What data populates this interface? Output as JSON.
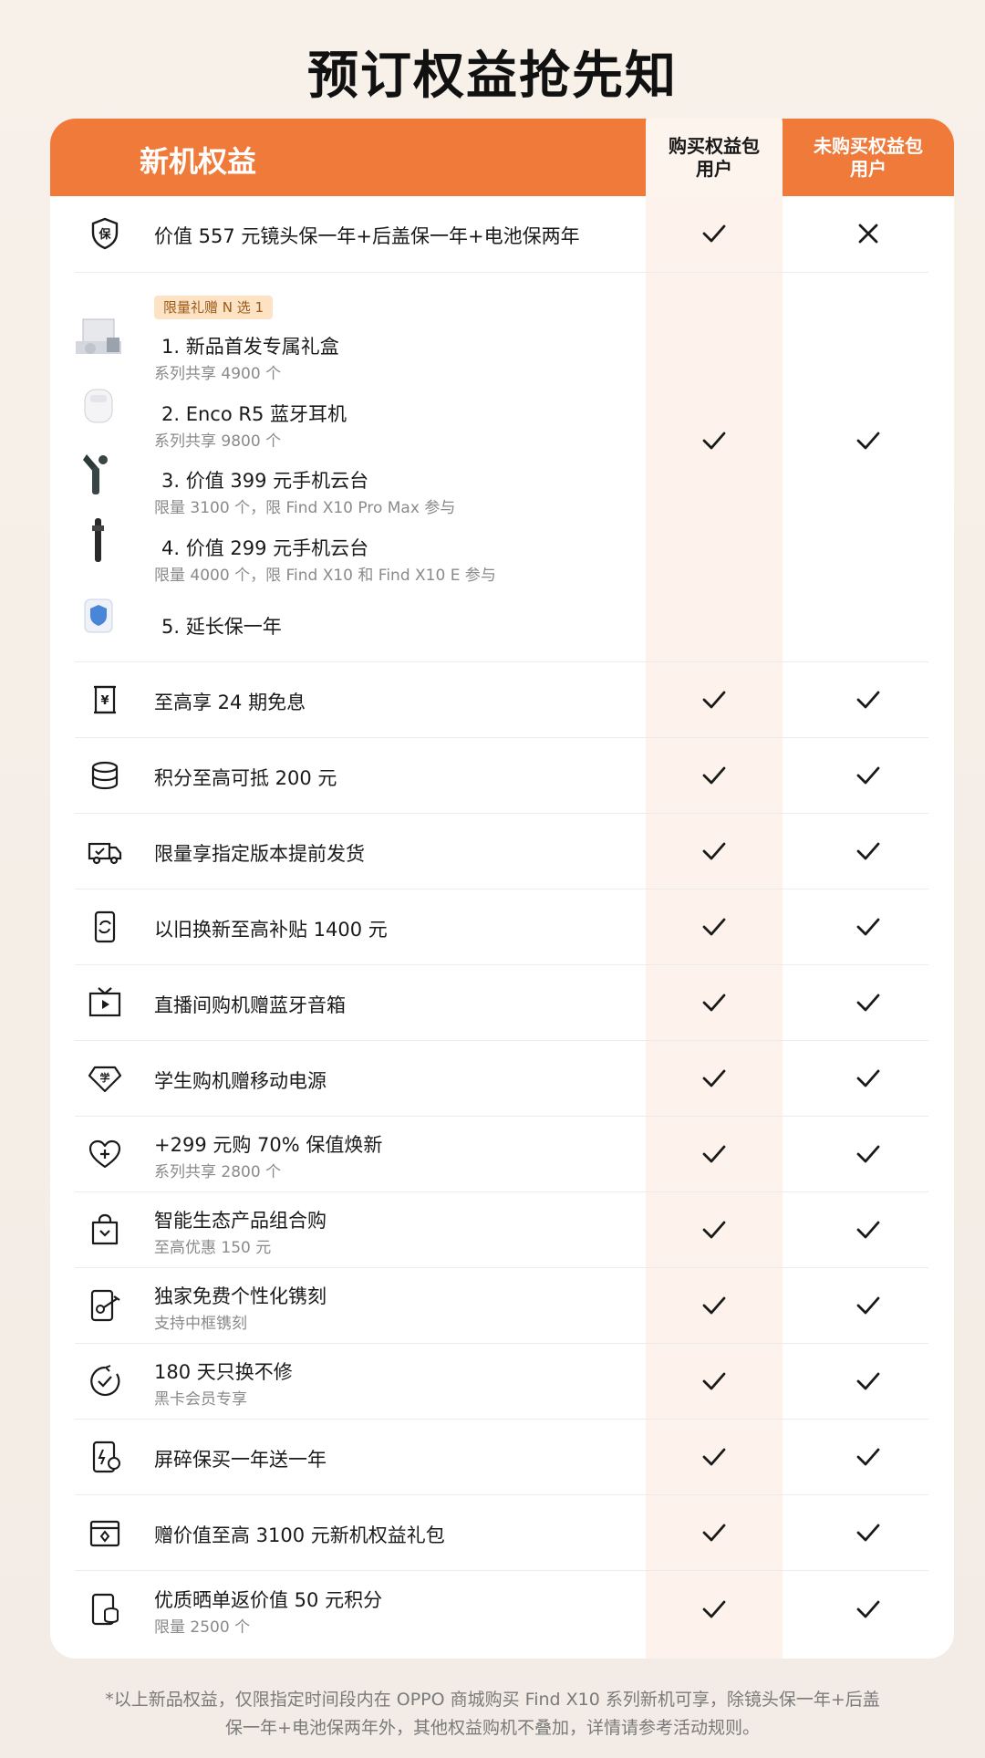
{
  "title": "预订权益抢先知",
  "header": {
    "section_title": "新机权益",
    "col1": "购买权益包\n用户",
    "col2": "未购买权益包\n用户"
  },
  "row_protection": {
    "icon": "shield-bao-icon",
    "label": "价值 557 元镜头保一年+后盖保一年+电池保两年",
    "col1": "check",
    "col2": "cross"
  },
  "gifts": {
    "tag": "限量礼赠 N 选 1",
    "items": [
      {
        "label": "1. 新品首发专属礼盒",
        "sub": "系列共享 4900 个",
        "thumb": "gift-box-thumbnail"
      },
      {
        "label": "2. Enco R5 蓝牙耳机",
        "sub": "系列共享 9800 个",
        "thumb": "earbuds-thumbnail"
      },
      {
        "label": "3. 价值 399 元手机云台",
        "sub": "限量 3100 个，限 Find X10 Pro Max 参与",
        "thumb": "gimbal-thumbnail"
      },
      {
        "label": "4. 价值 299 元手机云台",
        "sub": "限量 4000 个，限 Find X10 和 Find X10 E 参与",
        "thumb": "selfie-stick-thumbnail"
      },
      {
        "label": "5. 延长保一年",
        "sub": "",
        "thumb": "warranty-shield-thumbnail"
      }
    ],
    "col1": "check",
    "col2": "check"
  },
  "rows": [
    {
      "icon": "yuan-bill-icon",
      "label": "至高享 24 期免息",
      "sub": "",
      "col1": "check",
      "col2": "check"
    },
    {
      "icon": "coin-stack-icon",
      "label": "积分至高可抵 200 元",
      "sub": "",
      "col1": "check",
      "col2": "check"
    },
    {
      "icon": "delivery-truck-icon",
      "label": "限量享指定版本提前发货",
      "sub": "",
      "col1": "check",
      "col2": "check"
    },
    {
      "icon": "phone-refresh-icon",
      "label": "以旧换新至高补贴 1400 元",
      "sub": "",
      "col1": "check",
      "col2": "check"
    },
    {
      "icon": "tv-play-icon",
      "label": "直播间购机赠蓝牙音箱",
      "sub": "",
      "col1": "check",
      "col2": "check"
    },
    {
      "icon": "student-diamond-icon",
      "label": "学生购机赠移动电源",
      "sub": "",
      "col1": "check",
      "col2": "check"
    },
    {
      "icon": "heart-plus-icon",
      "label": "+299 元购 70% 保值焕新",
      "sub": "系列共享 2800 个",
      "col1": "check",
      "col2": "check"
    },
    {
      "icon": "shopping-bag-icon",
      "label": "智能生态产品组合购",
      "sub": "至高优惠 150 元",
      "col1": "check",
      "col2": "check"
    },
    {
      "icon": "engrave-phone-icon",
      "label": "独家免费个性化镌刻",
      "sub": "支持中框镌刻",
      "col1": "check",
      "col2": "check"
    },
    {
      "icon": "circle-check-icon",
      "label": "180 天只换不修",
      "sub": "黑卡会员专享",
      "col1": "check",
      "col2": "check"
    },
    {
      "icon": "broken-screen-icon",
      "label": "屏碎保买一年送一年",
      "sub": "",
      "col1": "check",
      "col2": "check"
    },
    {
      "icon": "gift-package-icon",
      "label": "赠价值至高 3100 元新机权益礼包",
      "sub": "",
      "col1": "check",
      "col2": "check"
    },
    {
      "icon": "phone-coins-icon",
      "label": "优质晒单返价值 50 元积分",
      "sub": "限量 2500 个",
      "col1": "check",
      "col2": "check"
    }
  ],
  "footer": {
    "line1": "*以上新品权益，仅限指定时间段内在 OPPO 商城购买 Find X10 系列新机可享，除镜头保一年+后盖",
    "line2": "保一年+电池保两年外，其他权益购机不叠加，详情请参考活动规则。"
  },
  "colors": {
    "accent": "#f07a3a",
    "highlight_column": "#fdf3ec",
    "tag_bg": "#fde3c4"
  }
}
